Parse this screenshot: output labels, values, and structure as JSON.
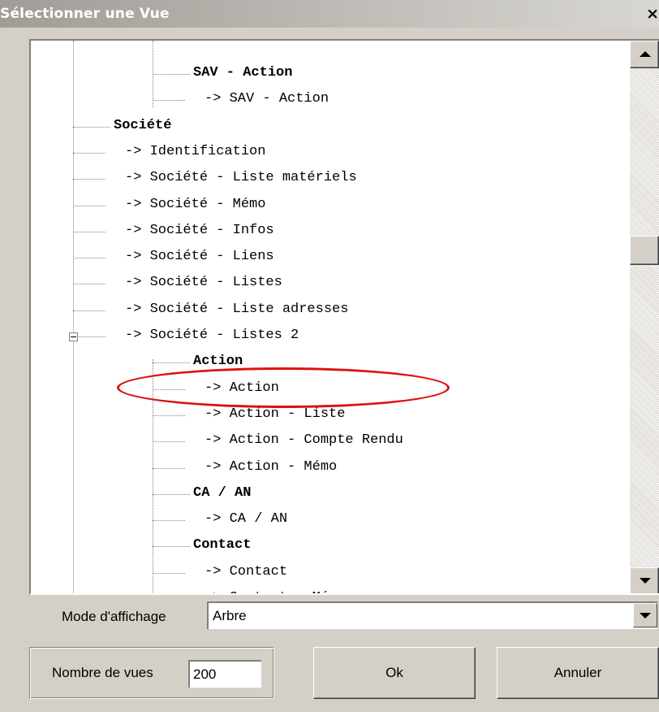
{
  "window": {
    "title": "Sélectionner une Vue",
    "close_glyph": "×"
  },
  "tree": {
    "rows": [
      {
        "text": "SAV - Action",
        "bold": true
      },
      {
        "text": "-> SAV - Action",
        "bold": false
      },
      {
        "text": "Société",
        "bold": true
      },
      {
        "text": "-> Identification",
        "bold": false
      },
      {
        "text": "-> Société - Liste matériels",
        "bold": false
      },
      {
        "text": "-> Société - Mémo",
        "bold": false
      },
      {
        "text": "-> Société - Infos",
        "bold": false
      },
      {
        "text": "-> Société - Liens",
        "bold": false
      },
      {
        "text": "-> Société - Listes",
        "bold": false
      },
      {
        "text": "-> Société - Liste adresses",
        "bold": false
      },
      {
        "text": "-> Société - Listes 2",
        "bold": false
      },
      {
        "text": "Action",
        "bold": true
      },
      {
        "text": "-> Action",
        "bold": false,
        "highlighted": true
      },
      {
        "text": "-> Action - Liste",
        "bold": false
      },
      {
        "text": "-> Action - Compte Rendu",
        "bold": false
      },
      {
        "text": "-> Action - Mémo",
        "bold": false
      },
      {
        "text": "CA / AN",
        "bold": true
      },
      {
        "text": "-> CA / AN",
        "bold": false
      },
      {
        "text": "Contact",
        "bold": true
      },
      {
        "text": "-> Contact",
        "bold": false
      },
      {
        "text": "-> Contact - Mémo",
        "bold": false
      }
    ]
  },
  "mode": {
    "label": "Mode d'affichage",
    "value": "Arbre"
  },
  "views_count": {
    "label": "Nombre de vues",
    "value": "200"
  },
  "buttons": {
    "ok": "Ok",
    "cancel": "Annuler"
  },
  "colors": {
    "highlight_circle": "#dd1111",
    "dialog_face": "#d4d0c8"
  }
}
